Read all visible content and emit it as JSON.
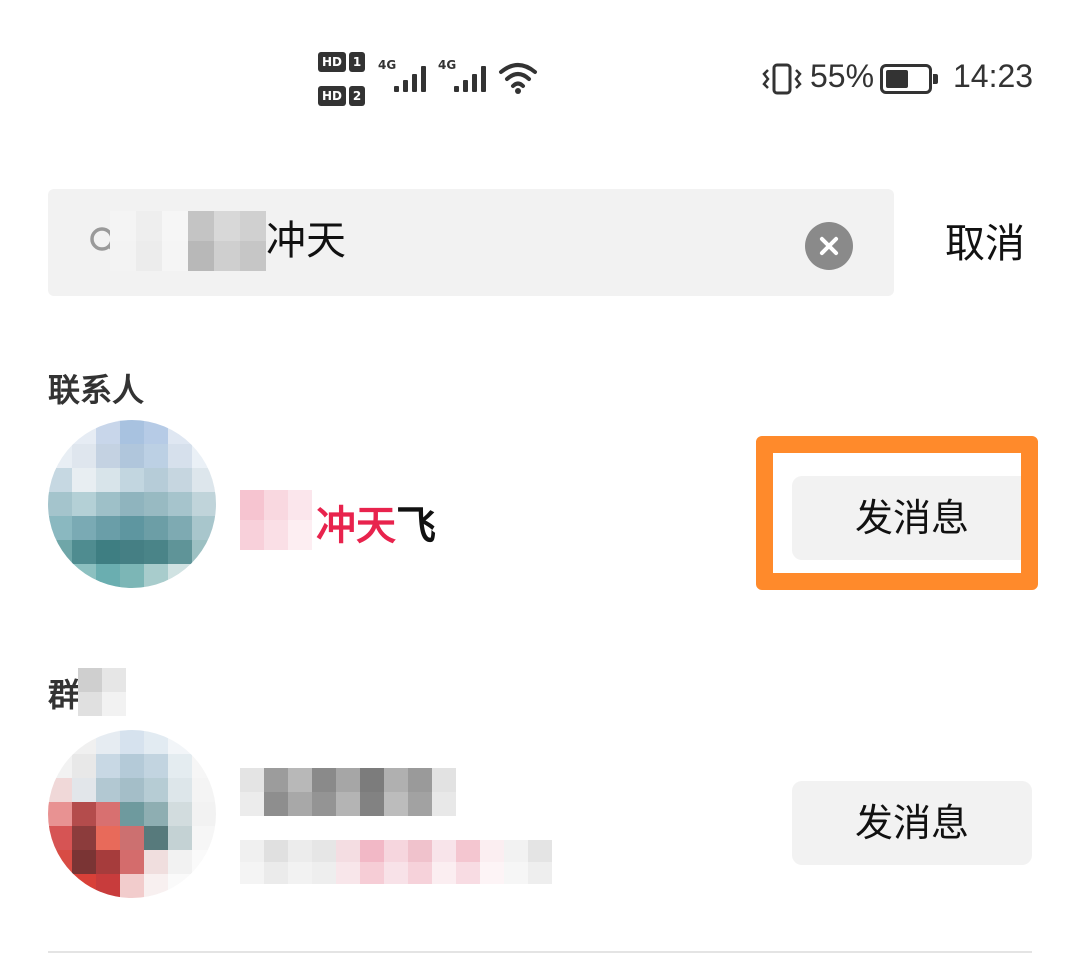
{
  "status_bar": {
    "hd1": "HD",
    "hd1_num": "1",
    "hd2": "HD",
    "hd2_num": "2",
    "sim1_net": "4G",
    "sim2_net": "4G",
    "battery_percent": "55%",
    "battery_level": 0.55,
    "time": "14:23"
  },
  "search": {
    "query_visible": "冲天",
    "cancel_label": "取消"
  },
  "sections": {
    "contacts_title": "联系人",
    "groups_title": "群聊"
  },
  "contacts": [
    {
      "name_highlight": "冲天",
      "name_suffix": "飞",
      "action_label": "发消息"
    }
  ],
  "groups": [
    {
      "action_label": "发消息"
    }
  ],
  "colors": {
    "highlight_text": "#e8234d",
    "annotation_box": "#ff8a2b",
    "button_bg": "#f2f2f2"
  }
}
